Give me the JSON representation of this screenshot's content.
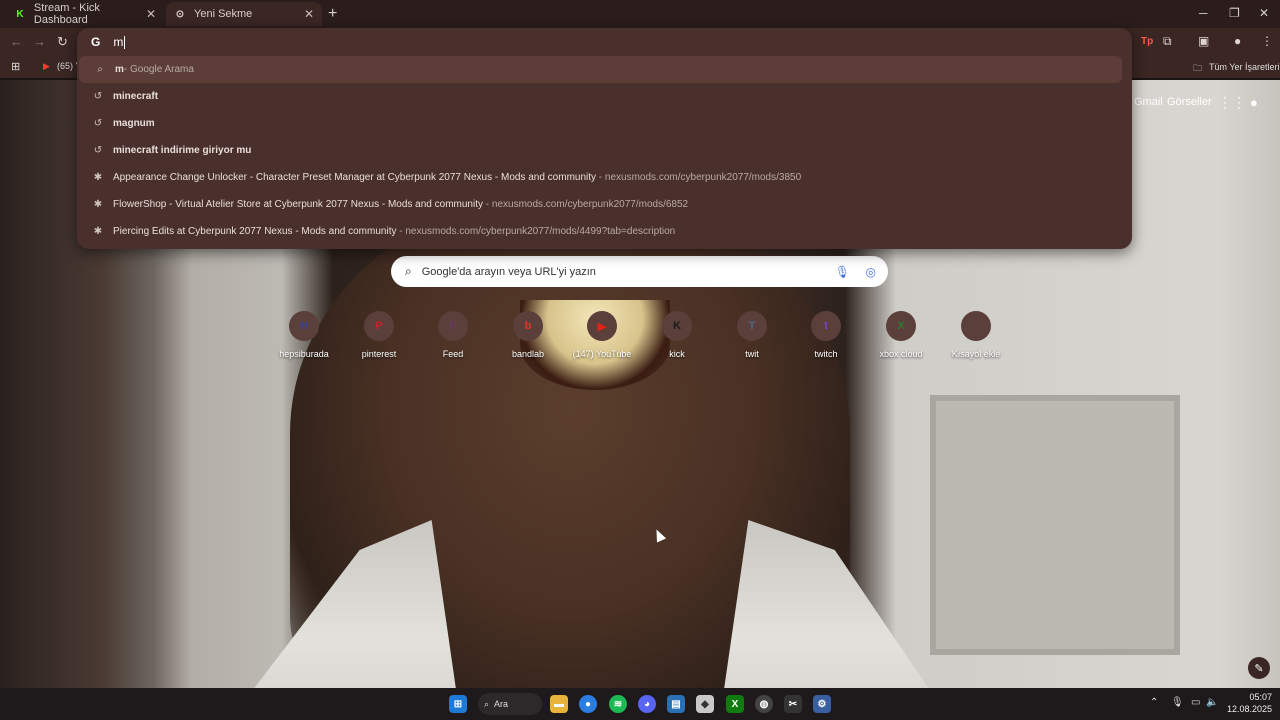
{
  "tabs": [
    {
      "title": "Stream - Kick Dashboard",
      "favicon": "K"
    },
    {
      "title": "Yeni Sekme",
      "favicon": "⊙"
    }
  ],
  "omnibox": {
    "query": "m",
    "suggestions": [
      {
        "bold": "m",
        "rest": " - Google Arama",
        "url": "",
        "icon": "search-icon"
      },
      {
        "bold": "m",
        "rest": "inecraft",
        "url": "",
        "icon": "history-icon"
      },
      {
        "bold": "m",
        "rest": "agnum",
        "url": "",
        "icon": "history-icon"
      },
      {
        "bold": "m",
        "rest": "inecraft indirime giriyor mu",
        "url": "",
        "icon": "history-icon"
      },
      {
        "text": "Appearance Change Unlocker - Character Preset Manager at Cyberpunk 2077 Nexus - Mods and community",
        "url": "nexusmods.com/cyberpunk2077/mods/3850",
        "icon": "nexus-icon"
      },
      {
        "text": "FlowerShop - Virtual Atelier Store at Cyberpunk 2077 Nexus - Mods and community",
        "url": "nexusmods.com/cyberpunk2077/mods/6852",
        "icon": "nexus-icon"
      },
      {
        "text": "Piercing Edits at Cyberpunk 2077 Nexus - Mods and community",
        "url": "nexusmods.com/cyberpunk2077/mods/4499?tab=description",
        "icon": "nexus-icon"
      }
    ]
  },
  "bookmarks": {
    "youtube_label": "(65) Y",
    "all_bookmarks": "Tüm Yer İşaretleri"
  },
  "ntp": {
    "gmail": "Gmail",
    "images": "Görseller",
    "search_placeholder": "Google'da arayın veya URL'yi yazın",
    "shortcuts": [
      {
        "label": "hepsiburada",
        "initial": "H",
        "color": "#3b3f9a"
      },
      {
        "label": "pinterest",
        "initial": "P",
        "color": "#c8232c"
      },
      {
        "label": "Feed",
        "initial": "R",
        "color": "#6a3a5a"
      },
      {
        "label": "bandlab",
        "initial": "b",
        "color": "#e2362e"
      },
      {
        "label": "(147) YouTube",
        "initial": "▶",
        "color": "#e62117"
      },
      {
        "label": "kick",
        "initial": "K",
        "color": "#1b1b1b"
      },
      {
        "label": "twit",
        "initial": "T",
        "color": "#4a6a8a"
      },
      {
        "label": "twitch",
        "initial": "t",
        "color": "#7a3fd0"
      },
      {
        "label": "xbox cloud",
        "initial": "X",
        "color": "#2f7a2f"
      },
      {
        "label": "Kısayol ekle",
        "initial": "+",
        "color": "#5a3f3a"
      }
    ]
  },
  "taskbar": {
    "search": "Ara",
    "time": "05:07",
    "date": "12.08.2025"
  }
}
